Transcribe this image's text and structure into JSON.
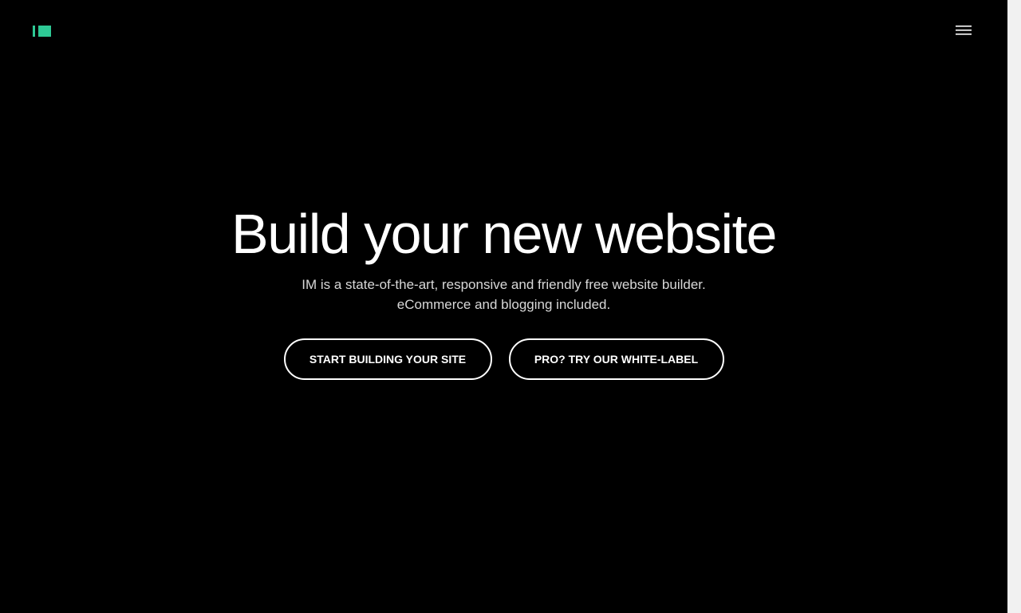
{
  "header": {
    "logo_icon": "im-logo-icon",
    "logo_color": "#2ec995",
    "menu_icon": "hamburger-menu-icon"
  },
  "hero": {
    "title": "Build your new website",
    "subtitle_line1": "IM is a state-of-the-art, responsive and friendly free website builder.",
    "subtitle_line2": "eCommerce and blogging included."
  },
  "cta": {
    "primary_label": "START BUILDING YOUR SITE",
    "secondary_label": "PRO? TRY OUR WHITE-LABEL"
  },
  "colors": {
    "background": "#000000",
    "text": "#ffffff",
    "accent": "#2ec995"
  }
}
